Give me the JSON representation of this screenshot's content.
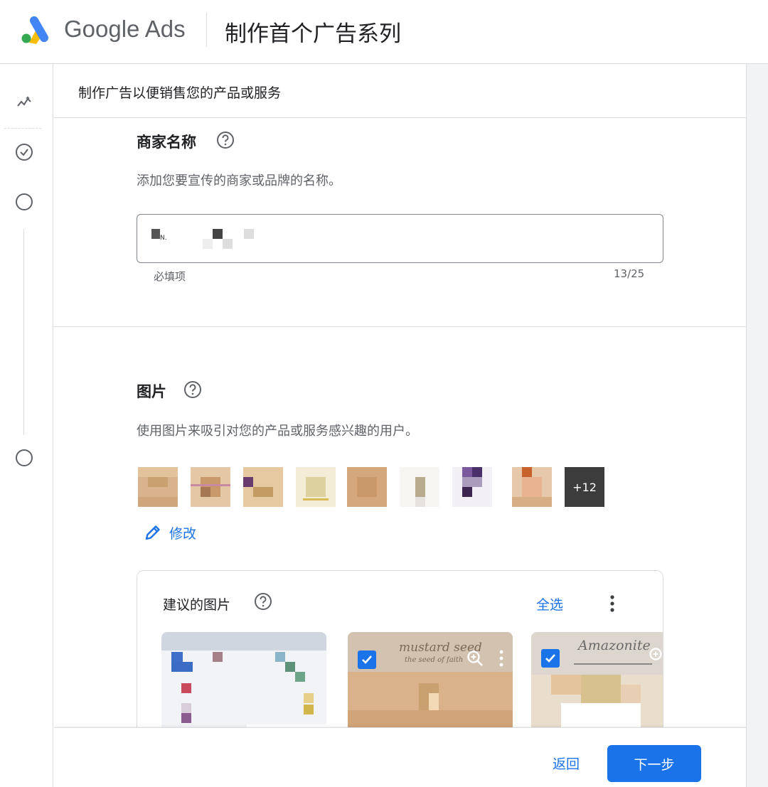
{
  "app": {
    "brand": "Google Ads",
    "page_title": "制作首个广告系列"
  },
  "rail": {
    "icons": [
      "sparkline-icon",
      "check-circle-icon",
      "circle-icon",
      "circle-icon"
    ]
  },
  "section": {
    "header": "制作广告以便销售您的产品或服务"
  },
  "business": {
    "title": "商家名称",
    "description": "添加您要宣传的商家或品牌的名称。",
    "value_visible": "N.",
    "hint": "必填项",
    "counter": "13/25"
  },
  "images": {
    "title": "图片",
    "description": "使用图片来吸引对您的产品或服务感兴趣的用户。",
    "more_badge": "+12",
    "edit_label": "修改"
  },
  "suggested": {
    "title": "建议的图片",
    "select_all": "全选",
    "items": [
      {
        "checked": false,
        "caption": ""
      },
      {
        "checked": true,
        "caption": "mustard seed",
        "subcaption": "the seed of faith"
      },
      {
        "checked": true,
        "caption": "Amazonite",
        "subcaption": ""
      }
    ]
  },
  "footer": {
    "back_label": "返回",
    "next_label": "下一步"
  },
  "colors": {
    "accent": "#1a73e8",
    "text": "#202124",
    "muted": "#5f6368",
    "border": "#dadce0"
  }
}
